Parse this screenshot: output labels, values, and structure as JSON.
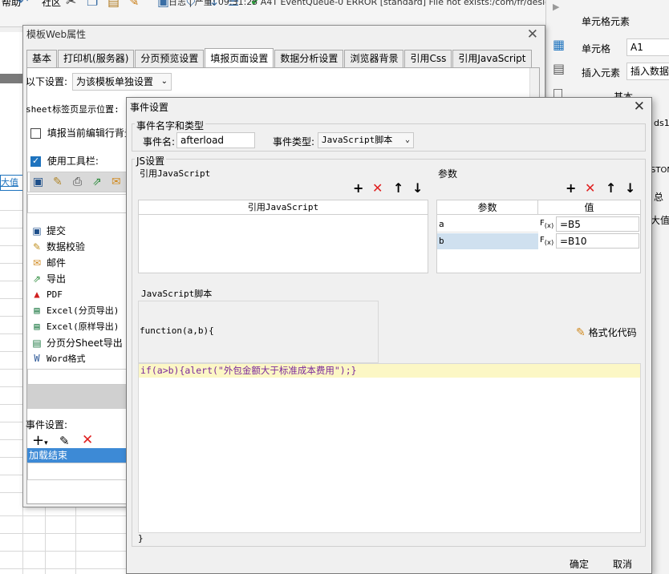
{
  "app_toolbar": {
    "log_text": "日志 | 严重: 09:31:25 A4T EventQueue-0 ERROR [standard] File not exists:/com/fr/design/images/plat..."
  },
  "menu_partial": {
    "item1": "帮助",
    "item2": "社区"
  },
  "right_panel": {
    "title": "单元格元素",
    "cell_label": "单元格",
    "cell_value": "A1",
    "insert_label": "插入元素",
    "insert_value": "插入数据",
    "basic_label": "基本",
    "clip1": "ds1",
    "clip2": "STOM",
    "clip3": "总",
    "clip4": "大值"
  },
  "sheet": {
    "cell1": "大值"
  },
  "web_window": {
    "title": "模板Web属性",
    "tabs": [
      "基本",
      "打印机(服务器)",
      "分页预览设置",
      "填报页面设置",
      "数据分析设置",
      "浏览器背景",
      "引用Css",
      "引用JavaScript"
    ],
    "settings_label": "以下设置:",
    "settings_value": "为该模板单独设置",
    "sheet_tab_label": "sheet标签页显示位置:",
    "highlight_label": "填报当前编辑行背景",
    "toolbar_label": "使用工具栏:",
    "toolbar_items": [
      "提交",
      "数据校验",
      "邮件",
      "导出",
      "PDF",
      "Excel(分页导出)",
      "Excel(原样导出)",
      "分页分Sheet导出",
      "Word格式"
    ],
    "event_label": "事件设置:",
    "event_item": "加载结束"
  },
  "event_dialog": {
    "title": "事件设置",
    "name_type_group": "事件名字和类型",
    "event_name_label": "事件名:",
    "event_name_value": "afterload",
    "event_type_label": "事件类型:",
    "event_type_value": "JavaScript脚本",
    "js_group": "JS设置",
    "ref_js_label": "引用JavaScript",
    "ref_js_header": "引用JavaScript",
    "params_label": "参数",
    "param_col": "参数",
    "value_col": "值",
    "params": [
      {
        "name": "a",
        "value": "=B5"
      },
      {
        "name": "b",
        "value": "=B10"
      }
    ],
    "script_label": "JavaScript脚本",
    "func_signature": "function(a,b){",
    "format_btn": "格式化代码",
    "code_line": "if(a>b){alert(\"外包金额大于标准成本费用\");}",
    "closing_brace": "}",
    "ok_btn": "确定",
    "cancel_btn": "取消"
  }
}
